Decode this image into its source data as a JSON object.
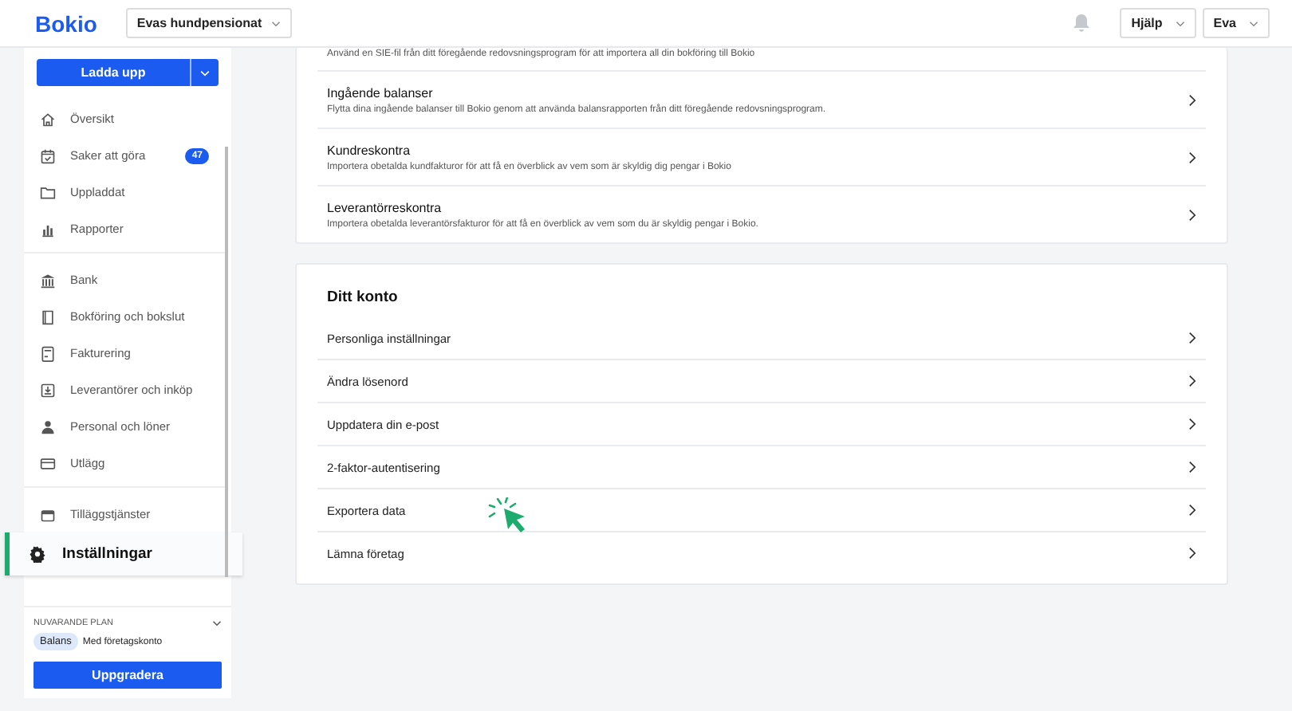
{
  "header": {
    "logo": "Bokio",
    "company": "Evas hundpensionat",
    "help": "Hjälp",
    "user": "Eva"
  },
  "sidebar": {
    "upload_button": "Ladda upp",
    "groups": [
      [
        {
          "label": "Översikt",
          "kind": "home",
          "selected": false
        },
        {
          "label": "Saker att göra",
          "kind": "calendar",
          "badge": "47",
          "selected": false
        },
        {
          "label": "Uppladdat",
          "kind": "folder",
          "selected": false
        },
        {
          "label": "Rapporter",
          "kind": "chart",
          "selected": false
        }
      ],
      [
        {
          "label": "Bank",
          "kind": "bank",
          "selected": false
        },
        {
          "label": "Bokföring och bokslut",
          "kind": "book",
          "selected": false
        },
        {
          "label": "Fakturering",
          "kind": "invoice",
          "selected": false
        },
        {
          "label": "Leverantörer och inköp",
          "kind": "inbox",
          "selected": false
        },
        {
          "label": "Personal och löner",
          "kind": "person",
          "selected": false
        },
        {
          "label": "Utlägg",
          "kind": "card",
          "selected": false
        }
      ],
      [
        {
          "label": "Tilläggstjänster",
          "kind": "store",
          "selected": false
        },
        {
          "label": "Inställningar",
          "kind": "gear",
          "selected": true
        }
      ]
    ],
    "plan": {
      "heading": "NUVARANDE PLAN",
      "tag": "Balans",
      "note": "Med företagskonto",
      "upgrade_button": "Uppgradera"
    }
  },
  "import_card": {
    "cut_text": "Använd en SIE-fil från ditt föregående redovsningsprogram för att importera all din bokföring till Bokio",
    "rows": [
      {
        "title": "Ingående balanser",
        "description": "Flytta dina ingående balanser till Bokio genom att använda balansrapporten från ditt föregående redovsningsprogram."
      },
      {
        "title": "Kundreskontra",
        "description": "Importera obetalda kundfakturor för att få en överblick av vem som är skyldig dig pengar i Bokio"
      },
      {
        "title": "Leverantörreskontra",
        "description": "Importera obetalda leverantörsfakturor för att få en överblick av vem som du är skyldig pengar i Bokio."
      }
    ]
  },
  "account_card": {
    "title": "Ditt konto",
    "rows": [
      {
        "label": "Personliga inställningar",
        "pointer": false
      },
      {
        "label": "Ändra lösenord",
        "pointer": false
      },
      {
        "label": "Uppdatera din e-post",
        "pointer": false
      },
      {
        "label": "2-faktor-autentisering",
        "pointer": false
      },
      {
        "label": "Exportera data",
        "pointer": true
      },
      {
        "label": "Lämna företag",
        "pointer": false
      }
    ]
  }
}
